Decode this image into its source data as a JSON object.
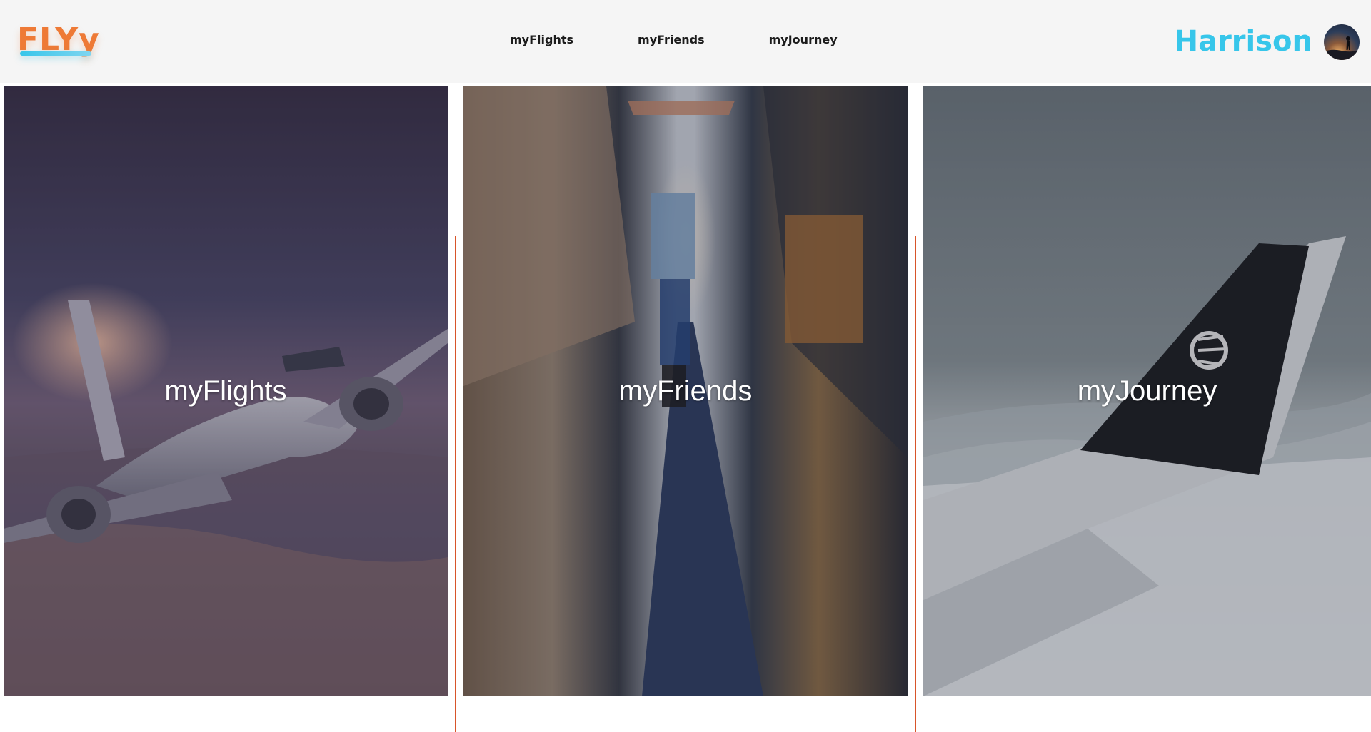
{
  "brand": {
    "logo_text": "FLYy",
    "logo_color": "#ee7a36",
    "underline_color": "#37c6ea"
  },
  "nav": {
    "items": [
      "myFlights",
      "myFriends",
      "myJourney"
    ]
  },
  "user": {
    "name": "Harrison",
    "name_color": "#37c6ea",
    "avatar_icon": "avatar-icon"
  },
  "panels": [
    {
      "label": "myFlights",
      "image": "airplane-in-flight-at-sunset"
    },
    {
      "label": "myFriends",
      "image": "airplane-cabin-aisle"
    },
    {
      "label": "myJourney",
      "image": "airplane-wing-above-clouds"
    }
  ],
  "accent": {
    "divider_color": "#d8552a"
  }
}
